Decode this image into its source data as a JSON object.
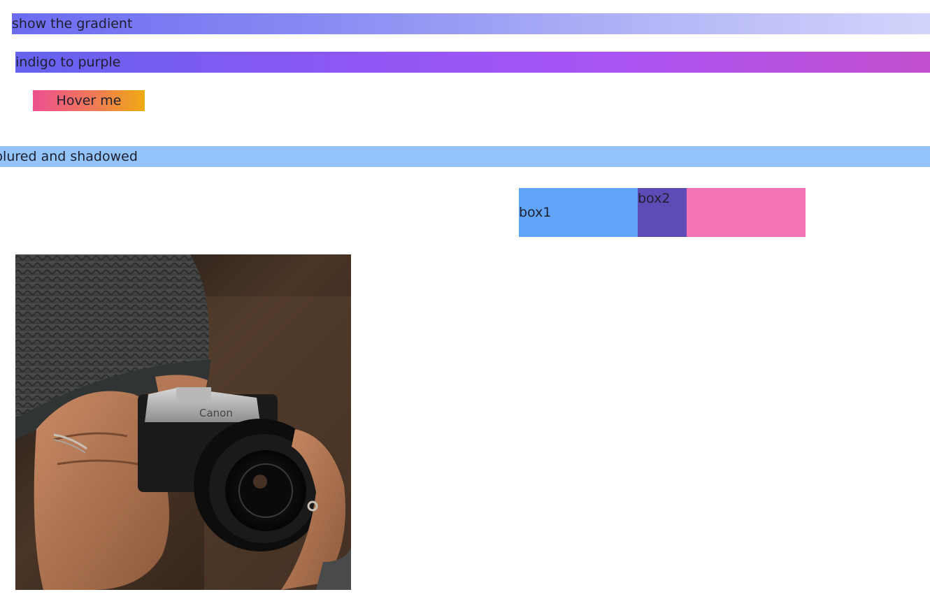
{
  "bars": {
    "gradient_label": "show the gradient",
    "indigo_label": "indigo to purple",
    "blurred_label": "blured and shadowed"
  },
  "button": {
    "hover_label": "Hover me"
  },
  "boxes": {
    "box1_label": "box1",
    "box2_label": "box2"
  },
  "photo": {
    "brand_text": "Canon",
    "description_icon": "photo-camera-person"
  },
  "colors": {
    "gradient_start": "#6d6cf1",
    "gradient_end": "#d3d4fb",
    "indigo": "#6563ef",
    "purple": "#c450d0",
    "button_start": "#ec4f8f",
    "button_end": "#eeaa14",
    "blurred_bar": "#93c5fb",
    "box1": "#60a5fa",
    "box2": "#5d4bb6",
    "box3": "#f472b6"
  }
}
